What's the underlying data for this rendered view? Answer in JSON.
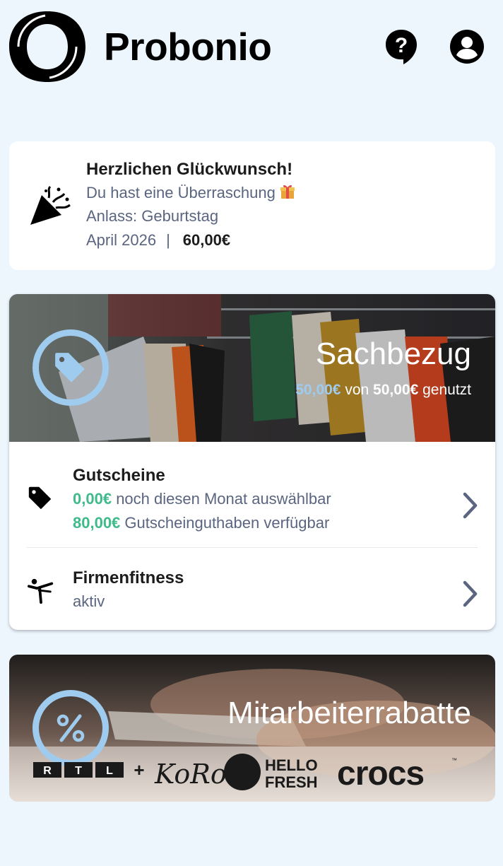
{
  "header": {
    "brand": "Probonio",
    "help_icon": "help-bubble-icon",
    "account_icon": "account-circle-icon"
  },
  "surprise": {
    "title": "Herzlichen Glückwunsch!",
    "line1": "Du hast eine Überraschung",
    "occasion": "Anlass: Geburtstag",
    "month": "April 2026",
    "separator": "|",
    "amount": "60,00€",
    "icon": "party-popper-icon"
  },
  "sachbezug": {
    "title": "Sachbezug",
    "used": "50,00€",
    "of_word": "von",
    "total": "50,00€",
    "used_word": "genutzt",
    "icon": "tag-icon",
    "items": [
      {
        "title": "Gutscheine",
        "line1_value": "0,00€",
        "line1_text": "noch diesen Monat auswählbar",
        "line2_value": "80,00€",
        "line2_text": "Gutscheinguthaben verfügbar",
        "icon": "tag-icon"
      },
      {
        "title": "Firmenfitness",
        "status": "aktiv",
        "icon": "fitness-person-icon"
      }
    ]
  },
  "rabatte": {
    "title": "Mitarbeiterrabatte",
    "icon": "percent-icon",
    "brands": [
      "R",
      "T",
      "L",
      "+",
      "KoRo",
      "HELLO",
      "FRESH",
      "crocs",
      "™"
    ]
  },
  "colors": {
    "background": "#edf5fd",
    "accent_blue": "#9fcbef",
    "accent_green": "#3fba8b",
    "muted_text": "#5a6580"
  }
}
